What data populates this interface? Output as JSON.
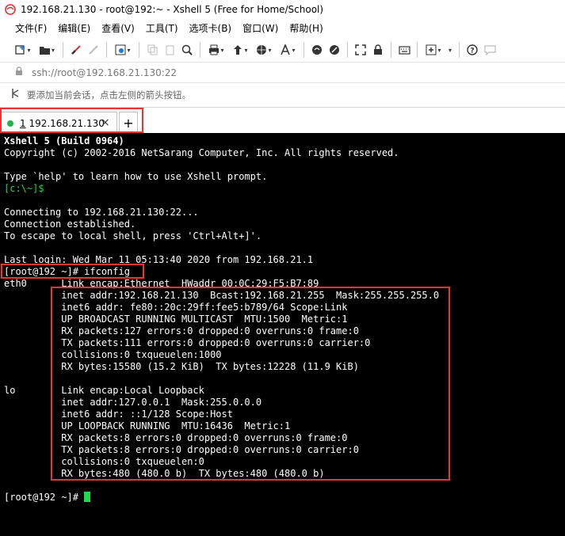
{
  "window": {
    "title": "192.168.21.130 - root@192:~ - Xshell 5 (Free for Home/School)"
  },
  "menu": [
    "文件(F)",
    "编辑(E)",
    "查看(V)",
    "工具(T)",
    "选项卡(B)",
    "窗口(W)",
    "帮助(H)"
  ],
  "toolbar_icons": [
    "new-session-icon",
    "open-folder-icon",
    "disconnect-icon",
    "reconnect-icon",
    "properties-icon",
    "copy-icon",
    "paste-icon",
    "find-icon",
    "print-icon",
    "transfer-icon",
    "globe-icon",
    "font-icon",
    "xftp-icon",
    "xmanager-icon",
    "fullscreen-icon",
    "lock-icon",
    "keyboard-icon",
    "new-tab-icon",
    "help-icon",
    "chat-icon"
  ],
  "address": {
    "url": "ssh://root@192.168.21.130:22"
  },
  "hint": {
    "text": "要添加当前会话，点击左侧的箭头按钮。"
  },
  "tab": {
    "index": "1",
    "label": " 192.168.21.130",
    "close": "×",
    "new": "+"
  },
  "terminal": {
    "lines": [
      {
        "text": "Xshell 5 (Build 0964)",
        "style": "bold"
      },
      {
        "text": "Copyright (c) 2002-2016 NetSarang Computer, Inc. All rights reserved.",
        "style": ""
      },
      {
        "text": "",
        "style": ""
      },
      {
        "text": "Type `help' to learn how to use Xshell prompt.",
        "style": ""
      },
      {
        "text": "[c:\\~]$",
        "style": "green"
      },
      {
        "text": "",
        "style": ""
      },
      {
        "text": "Connecting to 192.168.21.130:22...",
        "style": ""
      },
      {
        "text": "Connection established.",
        "style": ""
      },
      {
        "text": "To escape to local shell, press 'Ctrl+Alt+]'.",
        "style": ""
      },
      {
        "text": "",
        "style": ""
      },
      {
        "text": "Last login: Wed Mar 11 05:13:40 2020 from 192.168.21.1",
        "style": ""
      },
      {
        "text": "[root@192 ~]# ifconfig",
        "style": ""
      },
      {
        "text": "eth0      Link encap:Ethernet  HWaddr 00:0C:29:F5:B7:89",
        "style": ""
      },
      {
        "text": "          inet addr:192.168.21.130  Bcast:192.168.21.255  Mask:255.255.255.0",
        "style": ""
      },
      {
        "text": "          inet6 addr: fe80::20c:29ff:fee5:b789/64 Scope:Link",
        "style": ""
      },
      {
        "text": "          UP BROADCAST RUNNING MULTICAST  MTU:1500  Metric:1",
        "style": ""
      },
      {
        "text": "          RX packets:127 errors:0 dropped:0 overruns:0 frame:0",
        "style": ""
      },
      {
        "text": "          TX packets:111 errors:0 dropped:0 overruns:0 carrier:0",
        "style": ""
      },
      {
        "text": "          collisions:0 txqueuelen:1000",
        "style": ""
      },
      {
        "text": "          RX bytes:15580 (15.2 KiB)  TX bytes:12228 (11.9 KiB)",
        "style": ""
      },
      {
        "text": "",
        "style": ""
      },
      {
        "text": "lo        Link encap:Local Loopback",
        "style": ""
      },
      {
        "text": "          inet addr:127.0.0.1  Mask:255.0.0.0",
        "style": ""
      },
      {
        "text": "          inet6 addr: ::1/128 Scope:Host",
        "style": ""
      },
      {
        "text": "          UP LOOPBACK RUNNING  MTU:16436  Metric:1",
        "style": ""
      },
      {
        "text": "          RX packets:8 errors:0 dropped:0 overruns:0 frame:0",
        "style": ""
      },
      {
        "text": "          TX packets:8 errors:0 dropped:0 overruns:0 carrier:0",
        "style": ""
      },
      {
        "text": "          collisions:0 txqueuelen:0",
        "style": ""
      },
      {
        "text": "          RX bytes:480 (480.0 b)  TX bytes:480 (480.0 b)",
        "style": ""
      },
      {
        "text": "",
        "style": ""
      },
      {
        "text": "[root@192 ~]# ",
        "style": "prompt"
      }
    ]
  },
  "colors": {
    "terminal_bg": "#000000",
    "terminal_fg": "#ffffff",
    "prompt_green": "#22d84a",
    "highlight_red": "#ee3333",
    "tab_dot": "#22b14c"
  }
}
